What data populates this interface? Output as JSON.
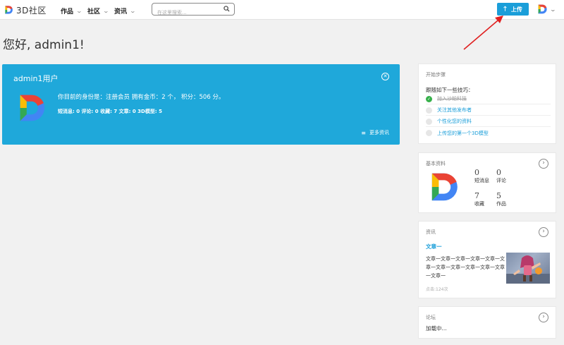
{
  "brand": {
    "name": "3D社区"
  },
  "nav": {
    "items": [
      {
        "label": "作品"
      },
      {
        "label": "社区"
      },
      {
        "label": "资讯"
      }
    ],
    "search_placeholder": "在这里搜索...",
    "upload_label": "上传"
  },
  "greeting": "您好, admin1!",
  "hero": {
    "title": "admin1用户",
    "identity_text": "你目前的身份是：注册会员 拥有金币：2 个， 积分：506 分。",
    "stats_text": "短消息: 0 评论: 0 收藏: 7 文章: 0 3D模型: 5",
    "more_label": "更多资讯"
  },
  "steps": {
    "header": "开始步骤",
    "intro": "跟随如下一些技巧：",
    "items": [
      {
        "label": "加入沙帕科技",
        "done": true
      },
      {
        "label": "关注其他发布者",
        "done": false
      },
      {
        "label": "个性化您的资料",
        "done": false
      },
      {
        "label": "上传您的第一个3D模型",
        "done": false
      }
    ]
  },
  "profile": {
    "header": "基本资料",
    "stats": [
      {
        "value": "0",
        "label": "短消息"
      },
      {
        "value": "0",
        "label": "评论"
      },
      {
        "value": "7",
        "label": "收藏"
      },
      {
        "value": "5",
        "label": "作品"
      }
    ]
  },
  "news": {
    "header": "资讯",
    "article_title": "文章一",
    "article_body": "文章一文章一文章一文章一文章一文章一文章一文章一文章一文章一文章一文章一",
    "clicks": "点击:124次"
  },
  "forum": {
    "header": "论坛",
    "loading": "加载中..."
  },
  "colors": {
    "accent": "#1fa8da",
    "button": "#1a9ed9",
    "done_green": "#36b04a",
    "annotation": "#e02020"
  }
}
